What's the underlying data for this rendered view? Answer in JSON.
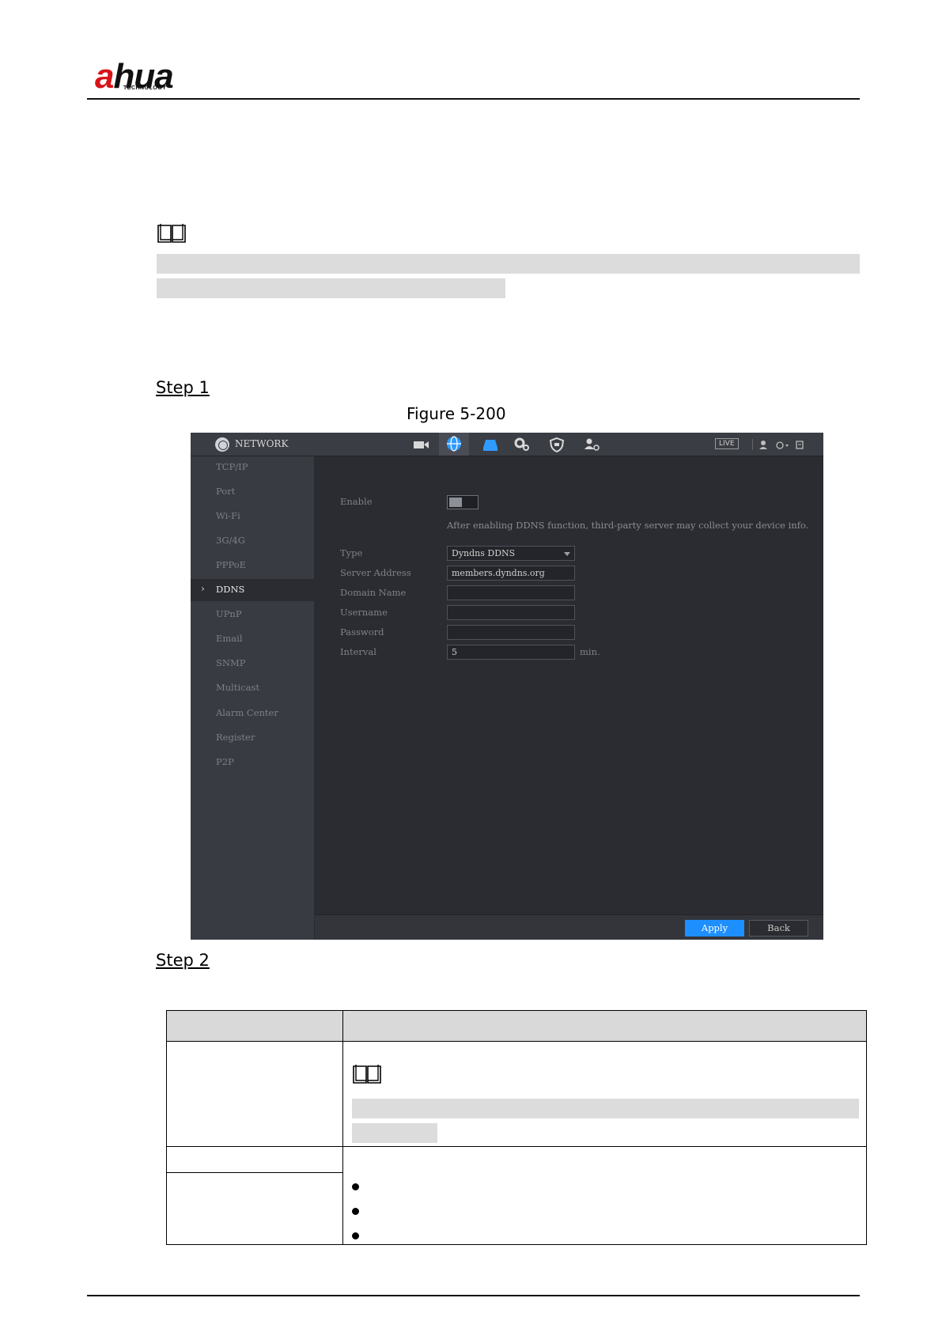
{
  "header": {
    "logo_text_pre": "a",
    "logo_text_post": "hua",
    "logo_sub": "TECHNOLOGY"
  },
  "steps": {
    "step1": "Step 1",
    "step2": "Step 2"
  },
  "figure": {
    "caption": "Figure 5-200"
  },
  "screen": {
    "title": "NETWORK",
    "live_badge": "LIVE",
    "sidebar": [
      {
        "label": "TCP/IP",
        "active": false
      },
      {
        "label": "Port",
        "active": false
      },
      {
        "label": "Wi-Fi",
        "active": false
      },
      {
        "label": "3G/4G",
        "active": false
      },
      {
        "label": "PPPoE",
        "active": false
      },
      {
        "label": "DDNS",
        "active": true
      },
      {
        "label": "UPnP",
        "active": false
      },
      {
        "label": "Email",
        "active": false
      },
      {
        "label": "SNMP",
        "active": false
      },
      {
        "label": "Multicast",
        "active": false
      },
      {
        "label": "Alarm Center",
        "active": false
      },
      {
        "label": "Register",
        "active": false
      },
      {
        "label": "P2P",
        "active": false
      }
    ],
    "form": {
      "enable_label": "Enable",
      "enable_on": false,
      "notice": "After enabling DDNS function, third-party server may collect your device info.",
      "type_label": "Type",
      "type_value": "Dyndns DDNS",
      "server_label": "Server Address",
      "server_value": "members.dyndns.org",
      "domain_label": "Domain Name",
      "domain_value": "",
      "username_label": "Username",
      "username_value": "",
      "password_label": "Password",
      "password_value": "",
      "interval_label": "Interval",
      "interval_value": "5",
      "interval_unit": "min."
    },
    "buttons": {
      "apply": "Apply",
      "back": "Back"
    },
    "colors": {
      "accent": "#1e8fff",
      "background": "#2b2c31",
      "sidebar": "#393b42"
    }
  }
}
